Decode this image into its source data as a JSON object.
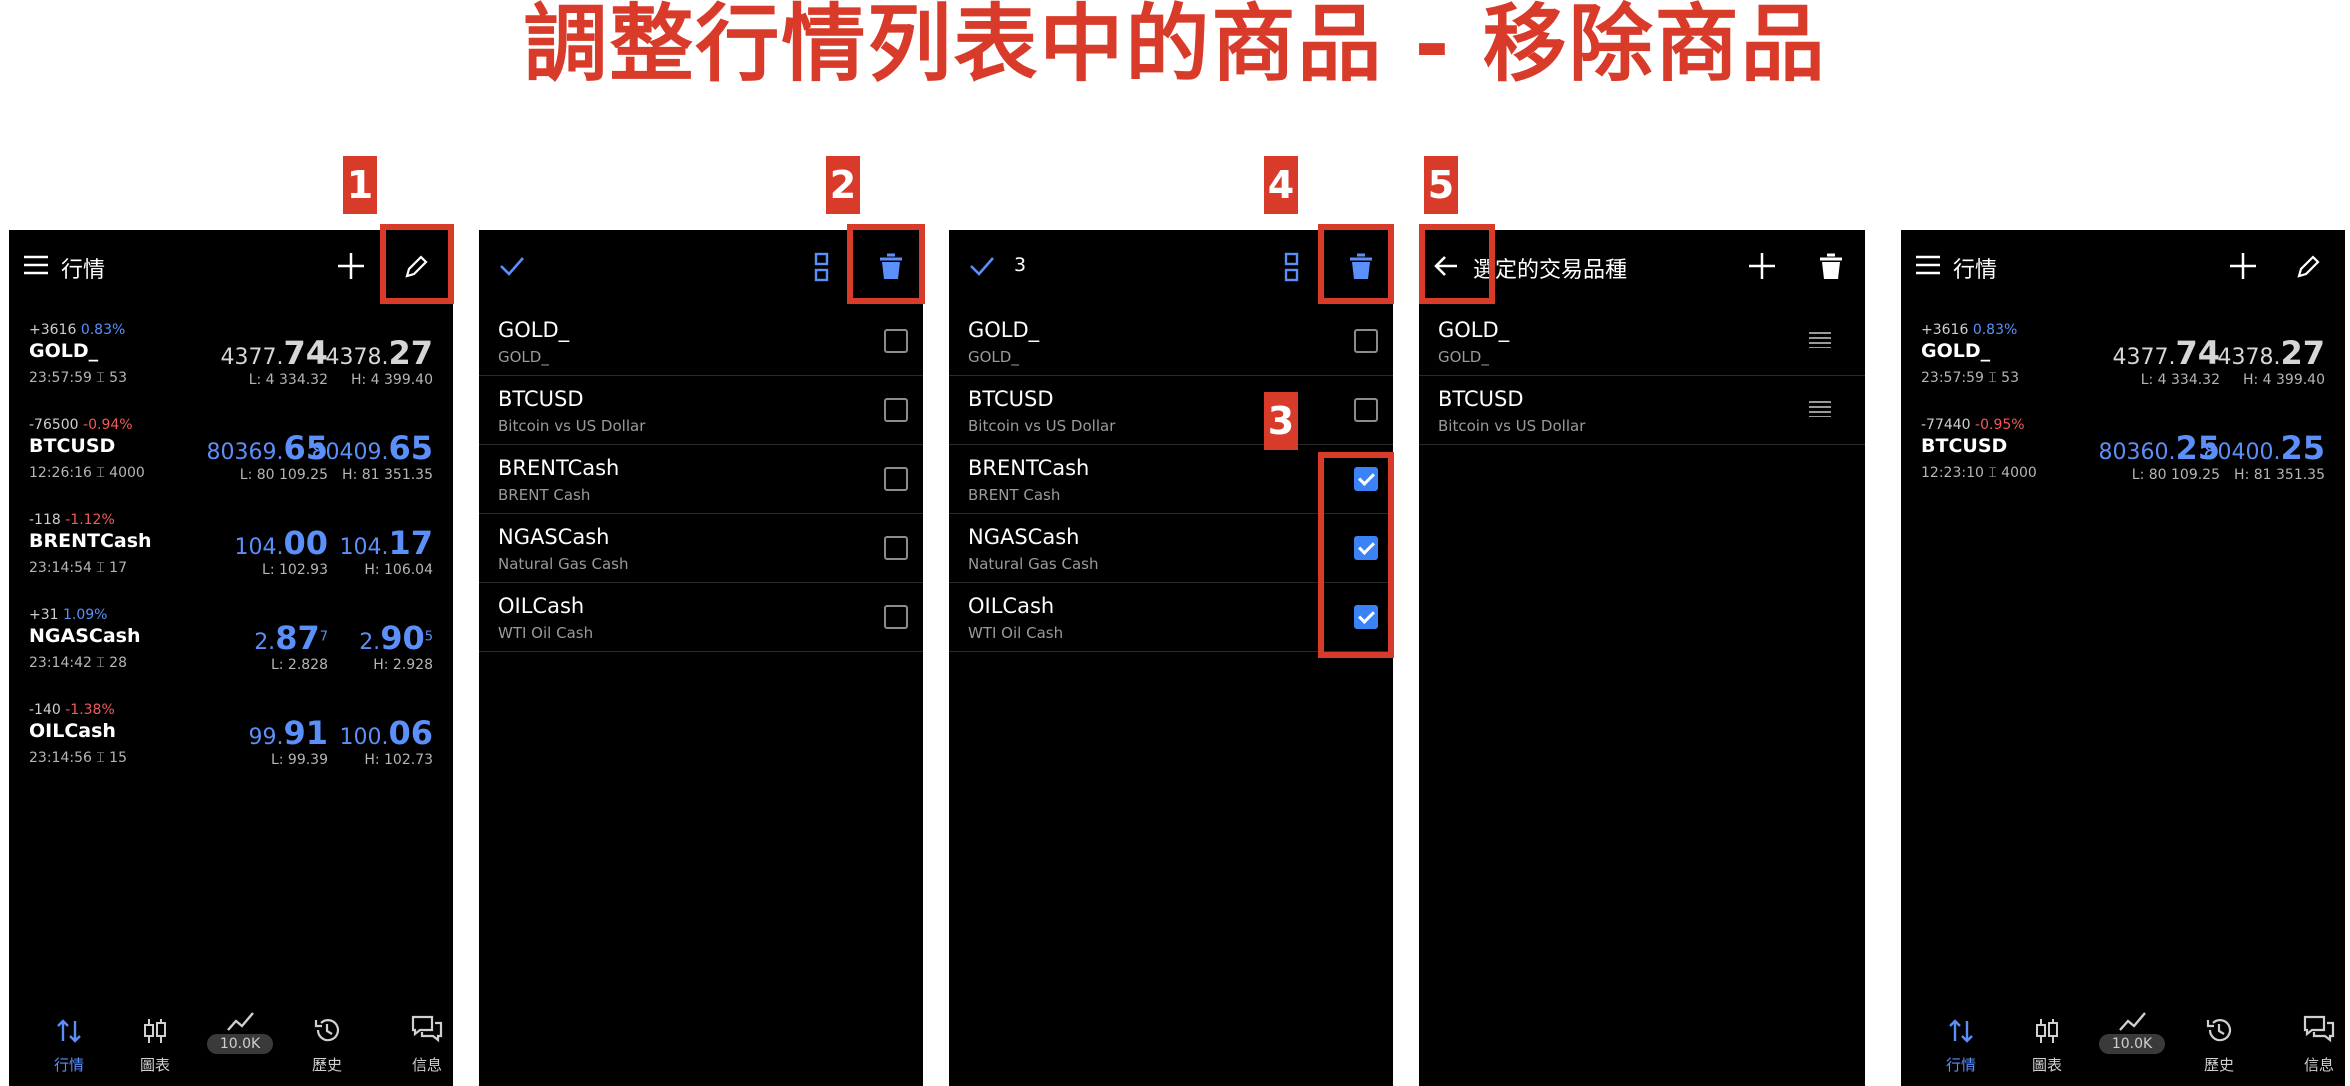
{
  "title": "調整行情列表中的商品 - 移除商品",
  "steps": [
    "1",
    "2",
    "3",
    "4",
    "5"
  ],
  "colors": {
    "accent": "#5b8ff9",
    "negative": "#f05a5a",
    "annotation": "#d93b2b",
    "panel_bg": "#000000"
  },
  "quotes_title": "行情",
  "edit_selected_count": "3",
  "selected_title": "選定的交易品種",
  "quotes_before": [
    {
      "pts": "+3616",
      "pct": "0.83%",
      "sym": "GOLD_",
      "time": "23:57:59 ⌶ 53",
      "bid_main": "4377.",
      "bid_big": "74",
      "bid_sup": "",
      "ask_main": "4378.",
      "ask_big": "27",
      "ask_sup": "",
      "low": "L: 4 334.32",
      "high": "H: 4 399.40"
    },
    {
      "pts": "-76500",
      "pct": "-0.94%",
      "sym": "BTCUSD",
      "time": "12:26:16 ⌶ 4000",
      "bid_main": "80369.",
      "bid_big": "65",
      "bid_sup": "",
      "ask_main": "80409.",
      "ask_big": "65",
      "ask_sup": "",
      "low": "L: 80 109.25",
      "high": "H: 81 351.35"
    },
    {
      "pts": "-118",
      "pct": "-1.12%",
      "sym": "BRENTCash",
      "time": "23:14:54 ⌶ 17",
      "bid_main": "104.",
      "bid_big": "00",
      "bid_sup": "",
      "ask_main": "104.",
      "ask_big": "17",
      "ask_sup": "",
      "low": "L: 102.93",
      "high": "H: 106.04"
    },
    {
      "pts": "+31",
      "pct": "1.09%",
      "sym": "NGASCash",
      "time": "23:14:42 ⌶ 28",
      "bid_main": "2.",
      "bid_big": "87",
      "bid_sup": "7",
      "ask_main": "2.",
      "ask_big": "90",
      "ask_sup": "5",
      "low": "L: 2.828",
      "high": "H: 2.928"
    },
    {
      "pts": "-140",
      "pct": "-1.38%",
      "sym": "OILCash",
      "time": "23:14:56 ⌶ 15",
      "bid_main": "99.",
      "bid_big": "91",
      "bid_sup": "",
      "ask_main": "100.",
      "ask_big": "06",
      "ask_sup": "",
      "low": "L: 99.39",
      "high": "H: 102.73"
    }
  ],
  "quotes_after": [
    {
      "pts": "+3616",
      "pct": "0.83%",
      "sym": "GOLD_",
      "time": "23:57:59 ⌶ 53",
      "bid_main": "4377.",
      "bid_big": "74",
      "ask_main": "4378.",
      "ask_big": "27",
      "low": "L: 4 334.32",
      "high": "H: 4 399.40"
    },
    {
      "pts": "-77440",
      "pct": "-0.95%",
      "sym": "BTCUSD",
      "time": "12:23:10 ⌶ 4000",
      "bid_main": "80360.",
      "bid_big": "25",
      "ask_main": "80400.",
      "ask_big": "25",
      "low": "L: 80 109.25",
      "high": "H: 81 351.35"
    }
  ],
  "symbols": [
    {
      "sym": "GOLD_",
      "desc": "GOLD_"
    },
    {
      "sym": "BTCUSD",
      "desc": "Bitcoin vs US Dollar"
    },
    {
      "sym": "BRENTCash",
      "desc": "BRENT Cash"
    },
    {
      "sym": "NGASCash",
      "desc": "Natural Gas Cash"
    },
    {
      "sym": "OILCash",
      "desc": "WTI Oil Cash"
    }
  ],
  "checked_panel3": [
    false,
    false,
    true,
    true,
    true
  ],
  "nav": {
    "quotes": "行情",
    "chart": "圖表",
    "trade_badge": "10.0K",
    "history": "歷史",
    "messages": "信息"
  }
}
